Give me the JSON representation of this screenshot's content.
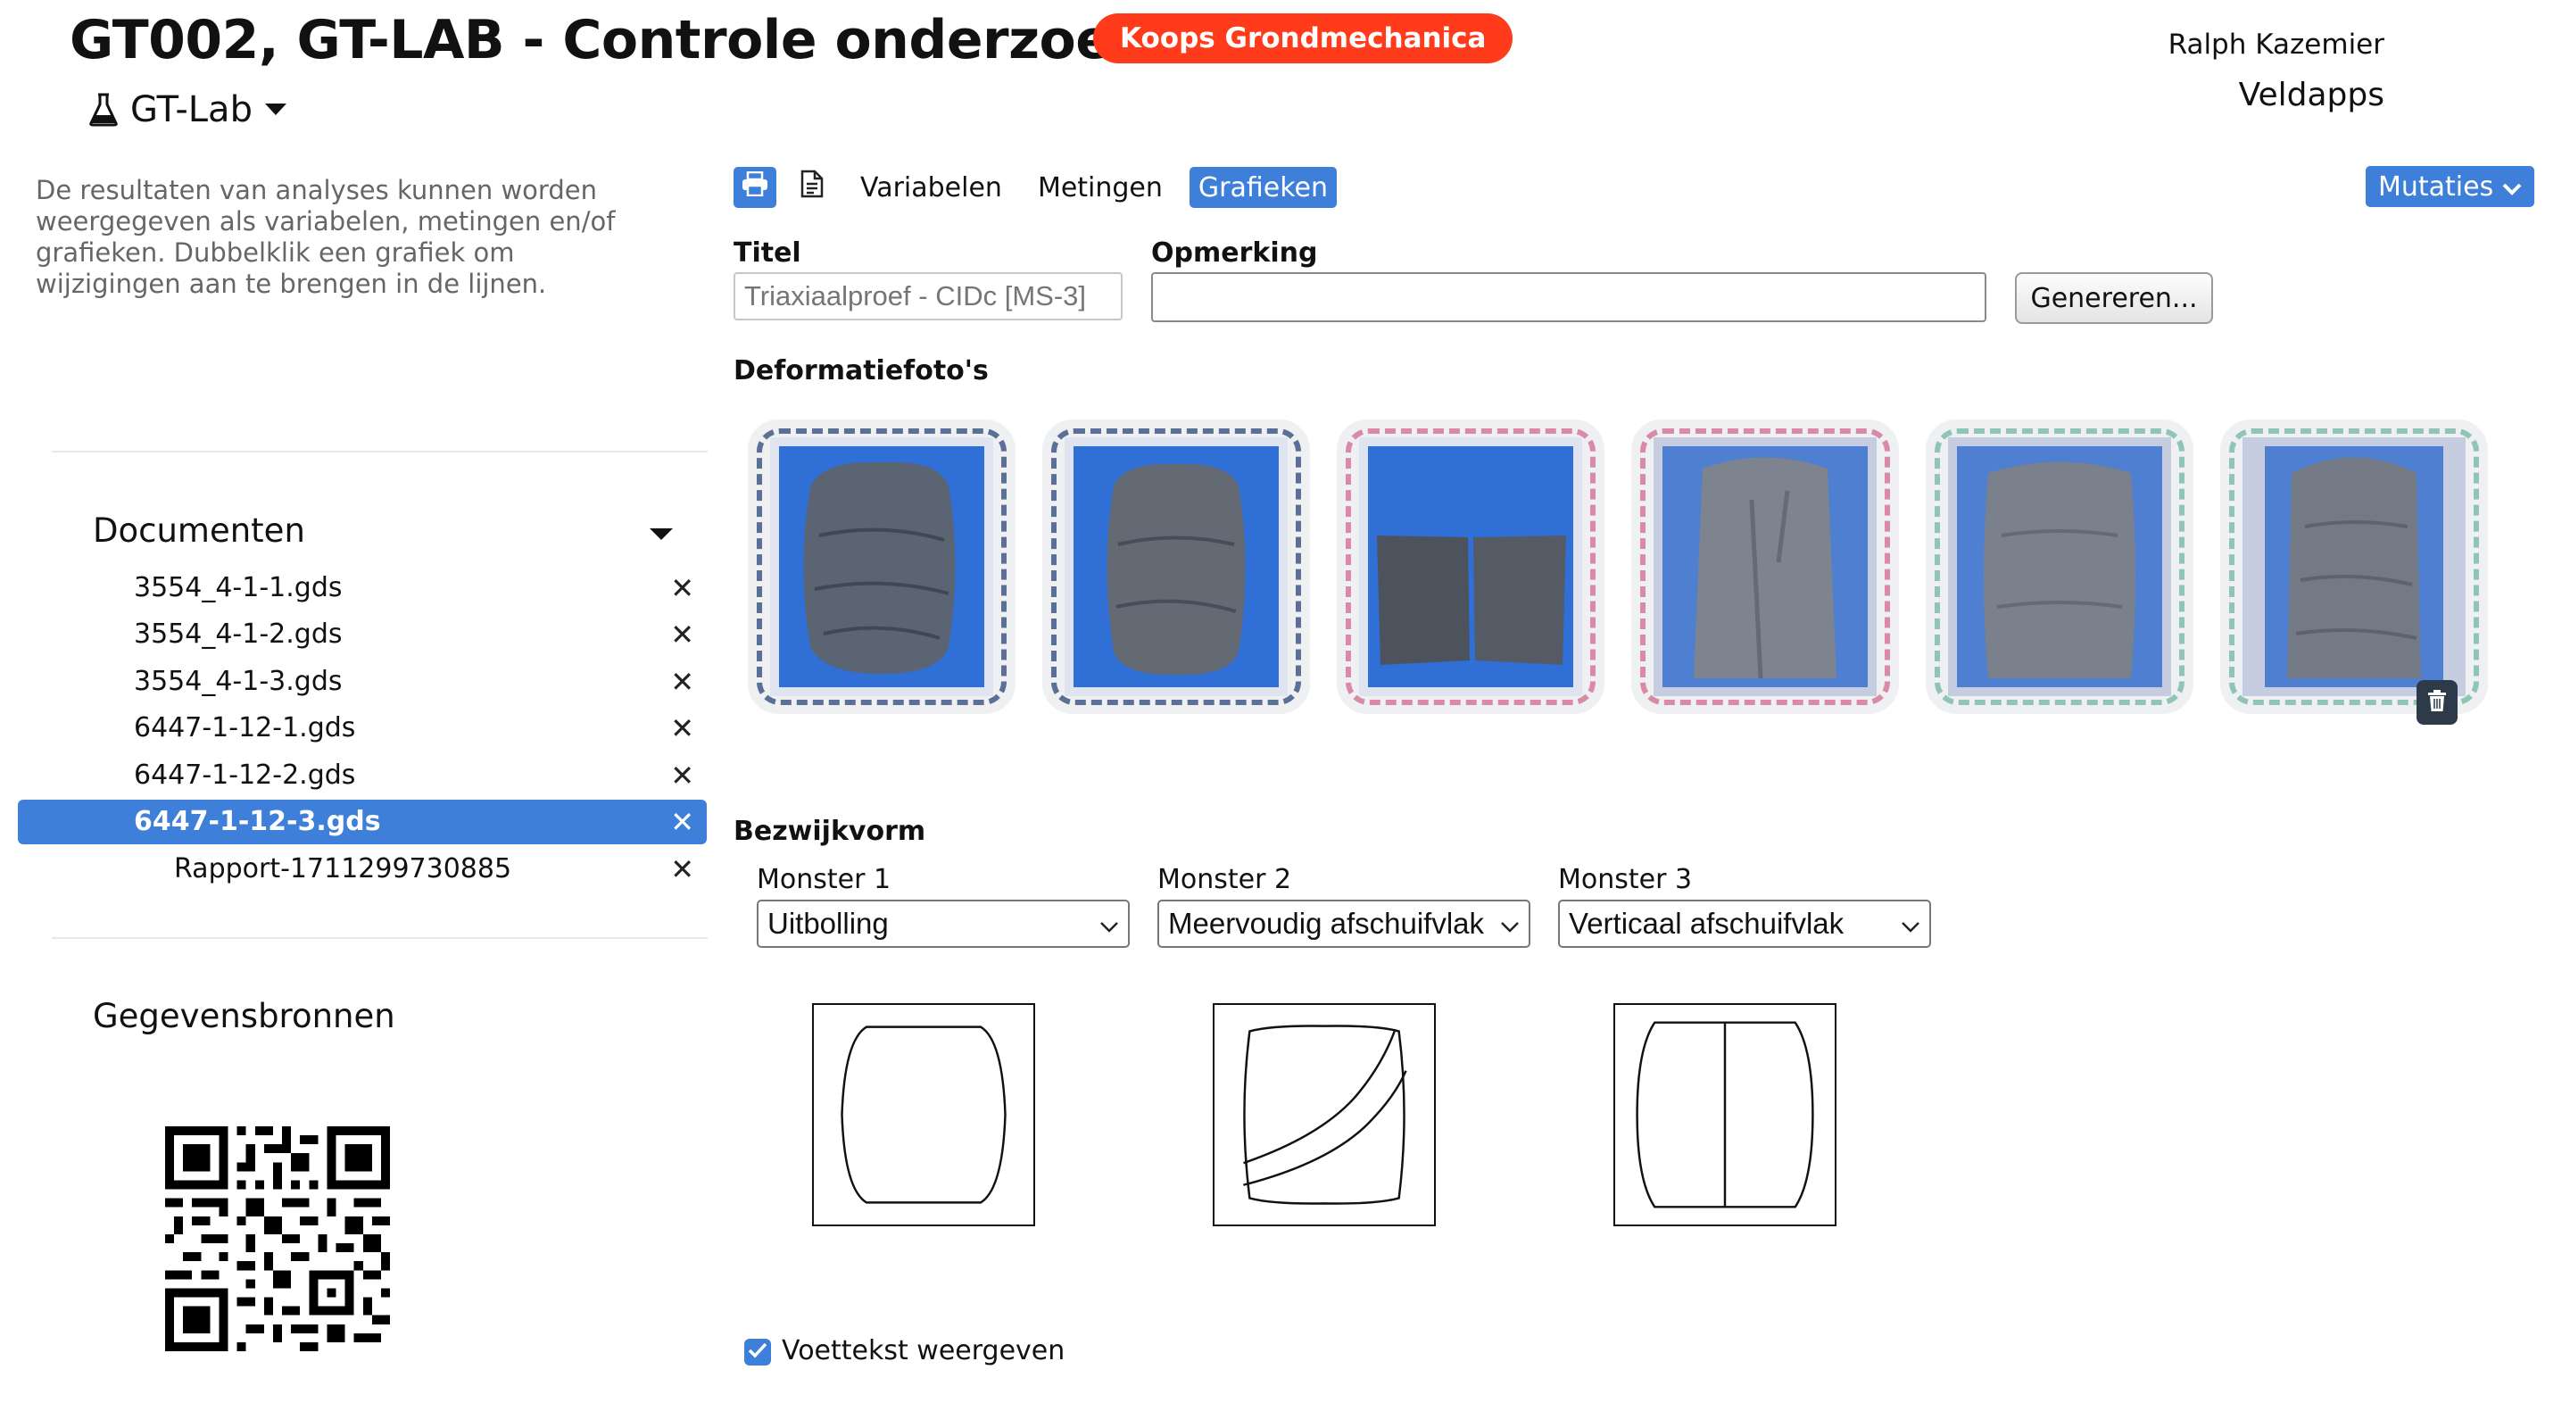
{
  "header": {
    "title": "GT002, GT-LAB - Controle onderzoek",
    "company_badge": "Koops Grondmechanica",
    "user_name": "Ralph Kazemier",
    "org_name": "Veldapps",
    "app_menu_label": "GT-Lab",
    "app_icon": "flask-icon"
  },
  "sidebar": {
    "intro": "De resultaten van analyses kunnen worden weergegeven als variabelen, metingen en/of grafieken. Dubbelklik een grafiek om wijzigingen aan te brengen in de lijnen.",
    "documents_heading": "Documenten",
    "documents": [
      {
        "label": "3554_4-1-1.gds"
      },
      {
        "label": "3554_4-1-2.gds"
      },
      {
        "label": "3554_4-1-3.gds"
      },
      {
        "label": "6447-1-12-1.gds"
      },
      {
        "label": "6447-1-12-2.gds"
      },
      {
        "label": "6447-1-12-3.gds",
        "selected": true
      },
      {
        "label": "Rapport-1711299730885",
        "child": true
      }
    ],
    "remove_symbol": "✕",
    "sources_heading": "Gegevensbronnen"
  },
  "toolbar": {
    "print_icon": "print-icon",
    "document_icon": "document-icon",
    "tabs": [
      "Variabelen",
      "Metingen",
      "Grafieken"
    ],
    "active_tab": "Grafieken",
    "mutaties_label": "Mutaties"
  },
  "form": {
    "title_label": "Titel",
    "title_placeholder": "Triaxiaalproef - CIDc [MS-3]",
    "note_label": "Opmerking",
    "note_value": "",
    "generate_label": "Genereren..."
  },
  "photos": {
    "heading": "Deformatiefoto's",
    "border_colors": [
      "#5c6f96",
      "#5c6f96",
      "#d98aa6",
      "#d98aa6",
      "#8fc4b6",
      "#8fc4b6"
    ]
  },
  "failure": {
    "heading": "Bezwijkvorm",
    "samples": [
      {
        "label": "Monster 1",
        "value": "Uitbolling"
      },
      {
        "label": "Monster 2",
        "value": "Meervoudig afschuifvlak"
      },
      {
        "label": "Monster 3",
        "value": "Verticaal afschuifvlak"
      }
    ]
  },
  "footer": {
    "show_footer_label": "Voettekst weergeven",
    "show_footer_checked": true
  },
  "colors": {
    "accent": "#3d7fd9",
    "badge": "#ff3b1c"
  }
}
